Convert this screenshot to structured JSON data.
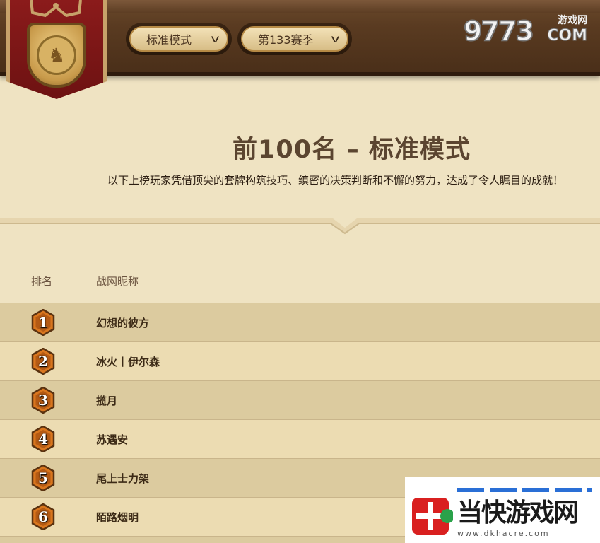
{
  "header": {
    "mode_select": {
      "value": "标准模式"
    },
    "season_select": {
      "value": "第133赛季"
    },
    "site_logo": {
      "number": "9773",
      "site": "游戏网",
      "com": "COM"
    }
  },
  "main": {
    "title": "前100名 – 标准模式",
    "subtitle": "以下上榜玩家凭借顶尖的套牌构筑技巧、缜密的决策判断和不懈的努力，达成了令人瞩目的成就！",
    "columns": {
      "rank": "排名",
      "name": "战网昵称"
    },
    "rows": [
      {
        "rank": "1",
        "name": "幻想的彼方"
      },
      {
        "rank": "2",
        "name": "冰火丨伊尔森"
      },
      {
        "rank": "3",
        "name": "揽月"
      },
      {
        "rank": "4",
        "name": "苏遇安"
      },
      {
        "rank": "5",
        "name": "尾上士力架"
      },
      {
        "rank": "6",
        "name": "陌路烟明"
      }
    ]
  },
  "watermark": {
    "text": "当快游戏网",
    "url": "www.dkhacre.com"
  },
  "colors": {
    "header_wood": "#5a3b21",
    "banner_red": "#8b1b1b",
    "page_bg": "#efe3c2",
    "row_dark": "#dccb9f",
    "row_light": "#ecdcb2",
    "badge_orange": "#d9761e"
  }
}
